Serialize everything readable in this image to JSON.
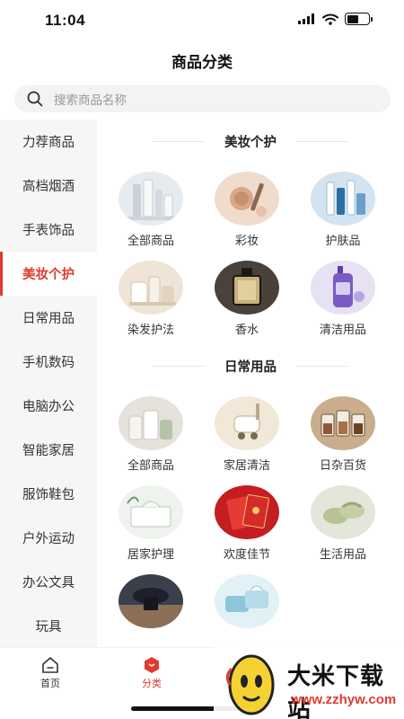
{
  "status_bar": {
    "time": "11:04"
  },
  "header": {
    "title": "商品分类"
  },
  "search": {
    "placeholder": "搜索商品名称"
  },
  "sidebar": {
    "active_index": 3,
    "items": [
      {
        "label": "力荐商品"
      },
      {
        "label": "高档烟酒"
      },
      {
        "label": "手表饰品"
      },
      {
        "label": "美妆个护"
      },
      {
        "label": "日常用品"
      },
      {
        "label": "手机数码"
      },
      {
        "label": "电脑办公"
      },
      {
        "label": "智能家居"
      },
      {
        "label": "服饰鞋包"
      },
      {
        "label": "户外运动"
      },
      {
        "label": "办公文具"
      },
      {
        "label": "玩具"
      }
    ]
  },
  "sections": [
    {
      "title": "美妆个护",
      "items": [
        {
          "label": "全部商品",
          "icon": "skincare-bottles-icon",
          "colors": [
            "#dfe5ea",
            "#f4f6f8"
          ]
        },
        {
          "label": "彩妆",
          "icon": "makeup-palette-icon",
          "colors": [
            "#e8c8b4",
            "#f5e3d6"
          ]
        },
        {
          "label": "护肤品",
          "icon": "skincare-set-icon",
          "colors": [
            "#bfd8ea",
            "#e9f2f8"
          ]
        },
        {
          "label": "染发护法",
          "icon": "hair-care-jars-icon",
          "colors": [
            "#e9dccb",
            "#f6efe4"
          ]
        },
        {
          "label": "香水",
          "icon": "perfume-bottle-icon",
          "colors": [
            "#3a3530",
            "#8a7a5e"
          ]
        },
        {
          "label": "清洁用品",
          "icon": "cleaning-bottle-icon",
          "colors": [
            "#d9d3ee",
            "#f1eef9"
          ]
        }
      ]
    },
    {
      "title": "日常用品",
      "items": [
        {
          "label": "全部商品",
          "icon": "household-jars-icon",
          "colors": [
            "#d8d6cc",
            "#efeee8"
          ]
        },
        {
          "label": "家居清洁",
          "icon": "vacuum-cleaner-icon",
          "colors": [
            "#eadfc9",
            "#f7f1e6"
          ]
        },
        {
          "label": "日杂百货",
          "icon": "food-containers-icon",
          "colors": [
            "#8c6a4a",
            "#d9c2a5"
          ]
        },
        {
          "label": "居家护理",
          "icon": "tissue-box-icon",
          "colors": [
            "#dfe8df",
            "#f3f7f3"
          ]
        },
        {
          "label": "欢度佳节",
          "icon": "red-envelope-icon",
          "colors": [
            "#b3121a",
            "#e53a35"
          ]
        },
        {
          "label": "生活用品",
          "icon": "slippers-icon",
          "colors": [
            "#d7dcc9",
            "#eef0e6"
          ]
        },
        {
          "label": "",
          "icon": "speaker-device-icon",
          "colors": [
            "#2a2e38",
            "#8d6f58"
          ]
        },
        {
          "label": "",
          "icon": "wet-wipes-icon",
          "colors": [
            "#cfe6ee",
            "#eef7fa"
          ]
        }
      ]
    }
  ],
  "tab_bar": {
    "tabs": [
      {
        "label": "首页"
      },
      {
        "label": "分类"
      }
    ]
  },
  "watermark": {
    "title": "大米下载站",
    "url": "www.zzhyw.com"
  },
  "colors": {
    "accent": "#e03b2e",
    "sidebar_bg": "#f6f6f6"
  }
}
